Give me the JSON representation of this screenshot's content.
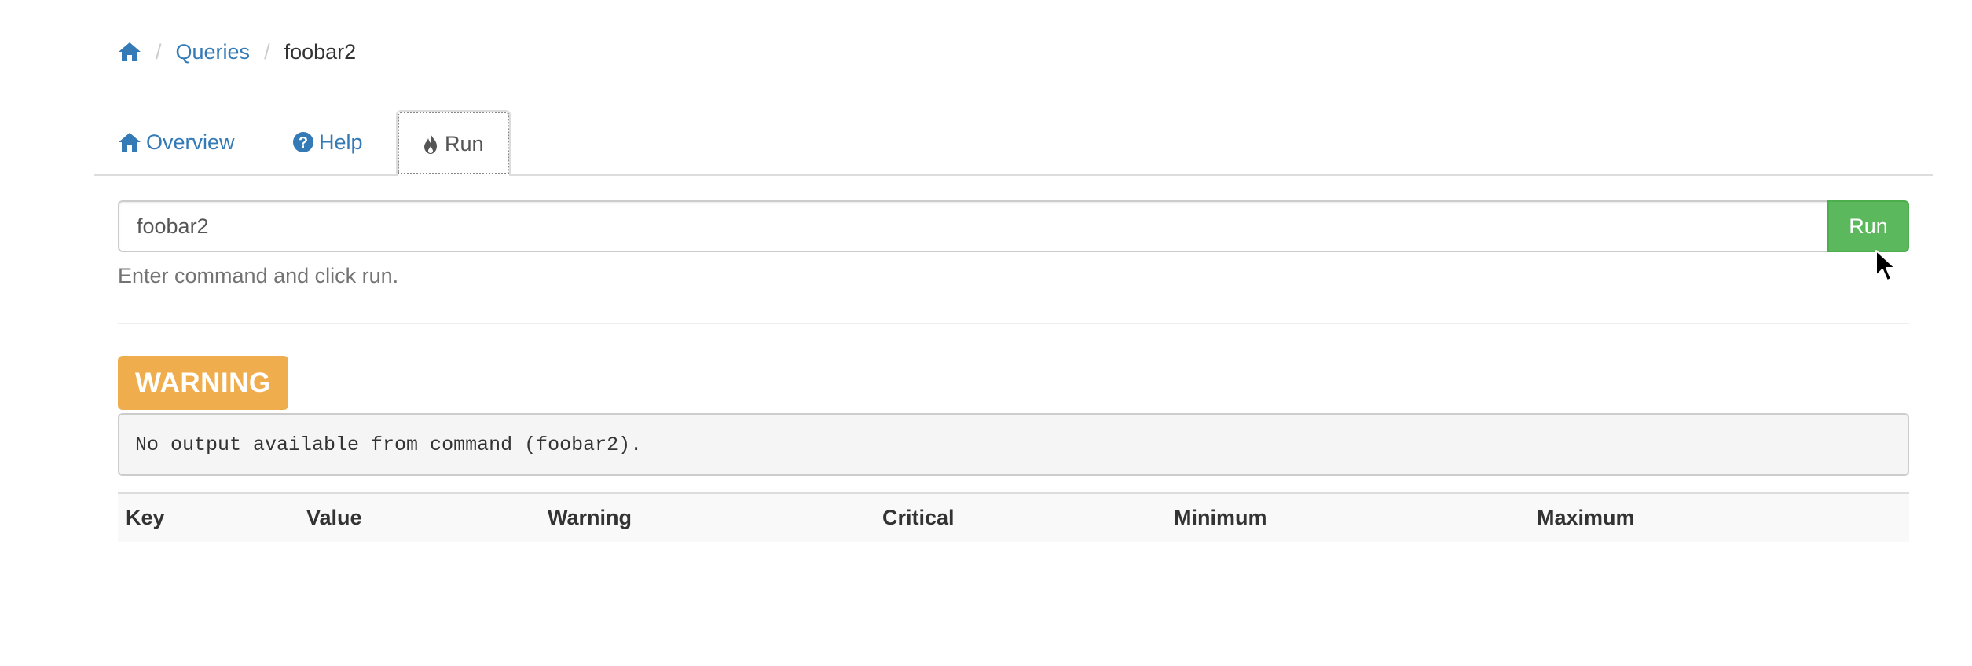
{
  "breadcrumb": {
    "home_icon": "home-icon",
    "items": [
      "Queries",
      "foobar2"
    ],
    "separator": "/"
  },
  "tabs": [
    {
      "label": "Overview",
      "icon": "home-icon",
      "active": false
    },
    {
      "label": "Help",
      "icon": "question-circle-icon",
      "active": false
    },
    {
      "label": "Run",
      "icon": "fire-icon",
      "active": true
    }
  ],
  "command": {
    "value": "foobar2",
    "run_label": "Run",
    "help_text": "Enter command and click run."
  },
  "result": {
    "status_label": "WARNING",
    "output": "No output available from command (foobar2)."
  },
  "table": {
    "columns": [
      "Key",
      "Value",
      "Warning",
      "Critical",
      "Minimum",
      "Maximum"
    ]
  },
  "colors": {
    "link": "#337ab7",
    "success": "#5cb85c",
    "warning": "#f0ad4e"
  }
}
